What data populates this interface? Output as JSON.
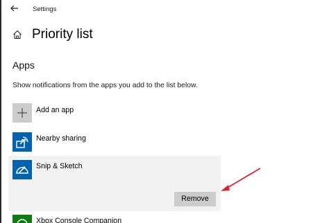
{
  "window": {
    "title": "Settings"
  },
  "page": {
    "title": "Priority list"
  },
  "apps_section": {
    "heading": "Apps",
    "description": "Show notifications from the apps you add to the list below."
  },
  "add_app": {
    "label": "Add an app"
  },
  "apps": [
    {
      "label": "Nearby sharing",
      "icon": "nearby-sharing-icon"
    },
    {
      "label": "Snip & Sketch",
      "icon": "snip-sketch-icon",
      "selected": true
    },
    {
      "label": "Xbox Console Companion",
      "icon": "xbox-icon"
    }
  ],
  "remove_button": {
    "label": "Remove"
  },
  "colors": {
    "accent": "#0063b1",
    "xbox": "#107c10",
    "annotation_arrow": "#e0202a",
    "selected_bg": "#f2f2f2",
    "button_bg": "#cccccc"
  }
}
